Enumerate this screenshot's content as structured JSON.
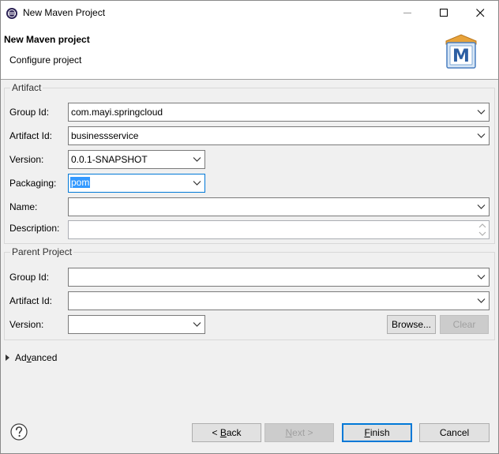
{
  "window": {
    "title": "New Maven Project",
    "icon": "eclipse-icon"
  },
  "header": {
    "title": "New Maven project",
    "subtitle": "Configure project",
    "logo_letter": "M"
  },
  "artifact": {
    "legend": "Artifact",
    "group_id_label": "Group Id:",
    "group_id_value": "com.mayi.springcloud",
    "artifact_id_label": "Artifact Id:",
    "artifact_id_value": "businessservice",
    "version_label": "Version:",
    "version_value": "0.0.1-SNAPSHOT",
    "packaging_label": "Packaging:",
    "packaging_value": "pom",
    "name_label": "Name:",
    "name_value": "",
    "description_label": "Description:",
    "description_value": ""
  },
  "parent": {
    "legend": "Parent Project",
    "group_id_label": "Group Id:",
    "group_id_value": "",
    "artifact_id_label": "Artifact Id:",
    "artifact_id_value": "",
    "version_label": "Version:",
    "version_value": "",
    "browse_label": "Browse...",
    "clear_label": "Clear"
  },
  "advanced": {
    "label_pre": "Ad",
    "label_mn": "v",
    "label_post": "anced"
  },
  "footer": {
    "back_pre": "< ",
    "back_mn": "B",
    "back_post": "ack",
    "next_pre": "",
    "next_mn": "N",
    "next_post": "ext >",
    "finish_pre": "",
    "finish_mn": "F",
    "finish_post": "inish",
    "cancel_label": "Cancel"
  },
  "colors": {
    "accent": "#0078d7",
    "selection": "#3399ff",
    "maven_blue": "#4a7fc0",
    "maven_orange": "#e8a33a"
  }
}
